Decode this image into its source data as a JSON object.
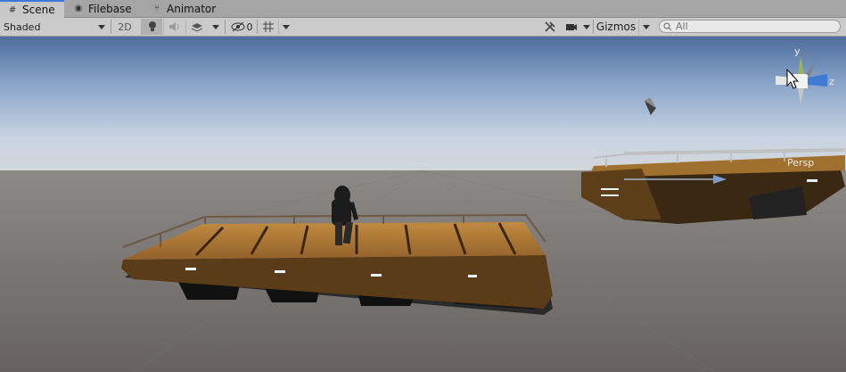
{
  "tabs": [
    {
      "label": "Scene",
      "icon": "hash-icon",
      "active": true
    },
    {
      "label": "Filebase",
      "icon": "eye-icon",
      "active": false
    },
    {
      "label": "Animator",
      "icon": "branch-icon",
      "active": false
    }
  ],
  "toolbar": {
    "shading_mode": "Shaded",
    "mode_2d_label": "2D",
    "hidden_count": "0",
    "gizmos_label": "Gizmos"
  },
  "search": {
    "placeholder": "All"
  },
  "scene_gizmo": {
    "axis_y": "y",
    "axis_z": "z",
    "projection": "Persp"
  },
  "colors": {
    "accent": "#3a79d9",
    "ground": "#6d6966",
    "sky_top": "#3e5f8f",
    "platform_wood": "#b07a33"
  }
}
